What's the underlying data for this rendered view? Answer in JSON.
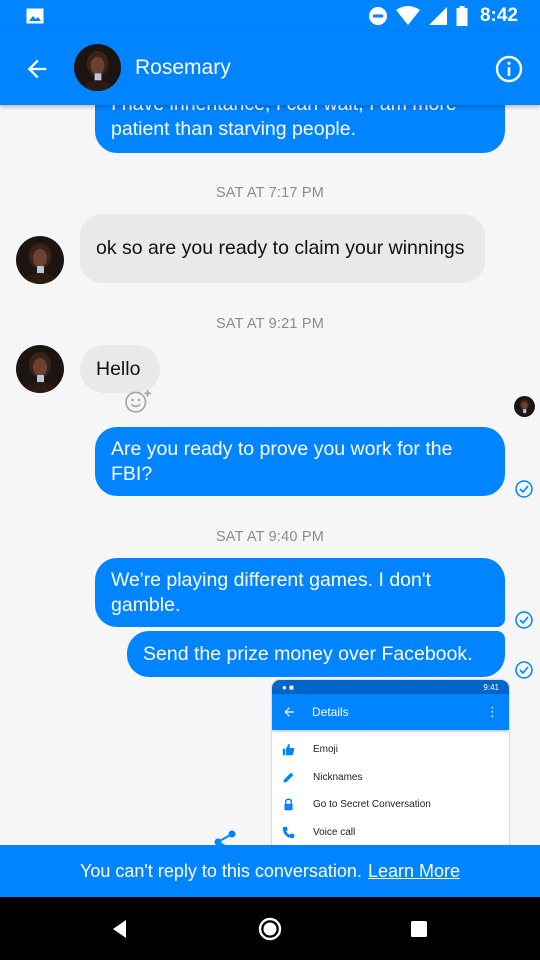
{
  "status_bar": {
    "time": "8:42",
    "icons": [
      "image-icon",
      "dnd-icon",
      "wifi-icon",
      "signal-icon",
      "battery-icon"
    ]
  },
  "header": {
    "contact_name": "Rosemary",
    "back_icon": "arrow-left-icon",
    "info_icon": "info-icon"
  },
  "messages": [
    {
      "id": "m1",
      "direction": "out",
      "text": "I have inheritance, I can wait, I am more patient than starving people."
    },
    {
      "id": "t1",
      "type": "timestamp",
      "text": "SAT AT 7:17 PM"
    },
    {
      "id": "m2",
      "direction": "in",
      "text": "ok so are you ready to claim your winnings"
    },
    {
      "id": "t2",
      "type": "timestamp",
      "text": "SAT AT 9:21 PM"
    },
    {
      "id": "m3",
      "direction": "in",
      "text": "Hello"
    },
    {
      "id": "m4",
      "direction": "out",
      "text": "Are you ready to prove you work for the FBI?"
    },
    {
      "id": "t3",
      "type": "timestamp",
      "text": "SAT AT 9:40 PM"
    },
    {
      "id": "m5",
      "direction": "out",
      "text": "We're playing different games. I don't gamble."
    },
    {
      "id": "m6",
      "direction": "out",
      "text": "Send the prize money over Facebook."
    }
  ],
  "attachment": {
    "status_time": "9:41",
    "title": "Details",
    "items": [
      {
        "label": "Emoji",
        "icon": "thumbs-up-icon"
      },
      {
        "label": "Nicknames",
        "icon": "pencil-icon"
      },
      {
        "label": "Go to Secret Conversation",
        "icon": "lock-icon"
      },
      {
        "label": "Voice call",
        "icon": "phone-icon"
      }
    ]
  },
  "footer": {
    "notice": "You can't reply to this conversation.",
    "link": "Learn More"
  },
  "colors": {
    "brand": "#0084ff",
    "incoming_bubble": "#e9e9e9",
    "timestamp": "#8b8b8b",
    "nav_bg": "#000000"
  }
}
